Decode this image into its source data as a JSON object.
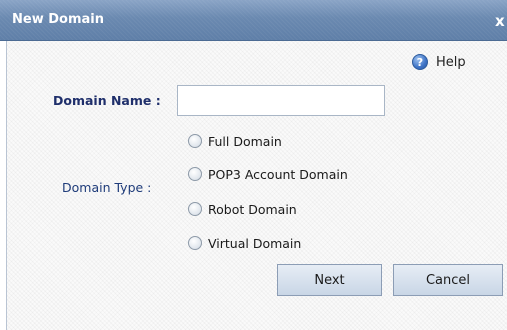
{
  "dialog": {
    "title": "New Domain",
    "close_glyph": "x"
  },
  "help": {
    "label": "Help",
    "icon": "help-icon",
    "glyph": "?"
  },
  "form": {
    "domain_name_label": "Domain Name :",
    "domain_name_value": "",
    "domain_type_label": "Domain Type :",
    "domain_types": [
      "Full Domain",
      "POP3 Account Domain",
      "Robot Domain",
      "Virtual Domain"
    ],
    "selected_type": null
  },
  "buttons": {
    "next_label": "Next",
    "cancel_label": "Cancel"
  },
  "colors": {
    "titlebar": "#6c8bb3",
    "label_text": "#1f2f6b",
    "button_fill": "#c9d6e6"
  }
}
